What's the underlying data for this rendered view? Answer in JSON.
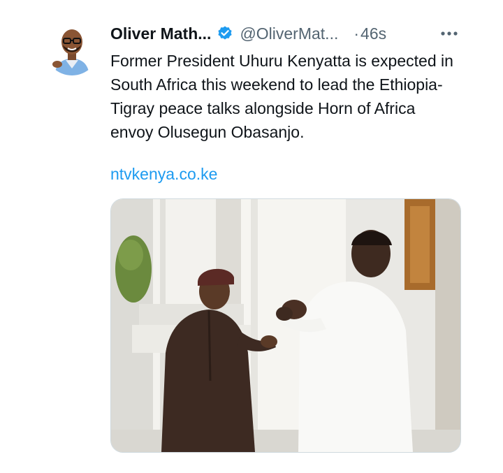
{
  "tweet": {
    "author": {
      "display_name": "Oliver Math...",
      "handle": "@OliverMat...",
      "verified_icon": "verified-badge-icon",
      "avatar_icon": "avatar"
    },
    "separator": "·",
    "timestamp": "46s",
    "more_icon": "more-options-icon",
    "text": "Former President Uhuru Kenyatta is expected in South Africa this weekend to lead the Ethiopia-Tigray peace talks alongside Horn of Africa envoy Olusegun Obasanjo.",
    "link": "ntvkenya.co.ke",
    "media": {
      "type": "photo"
    }
  },
  "colors": {
    "link": "#1d9bf0",
    "secondary_text": "#536471",
    "verified": "#1d9bf0"
  }
}
